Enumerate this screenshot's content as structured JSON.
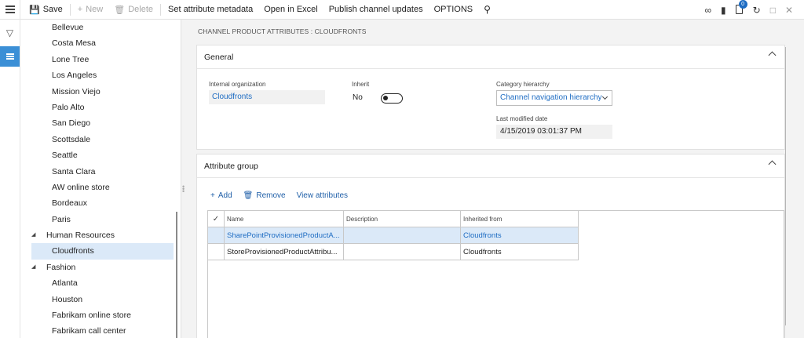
{
  "toolbar": {
    "save": "Save",
    "new": "New",
    "delete": "Delete",
    "set_attribute_metadata": "Set attribute metadata",
    "open_in_excel": "Open in Excel",
    "publish_channel_updates": "Publish channel updates",
    "options": "OPTIONS",
    "notification_count": "0"
  },
  "tree": {
    "items": [
      {
        "label": "Bellevue",
        "type": "leaf"
      },
      {
        "label": "Costa Mesa",
        "type": "leaf"
      },
      {
        "label": "Lone Tree",
        "type": "leaf"
      },
      {
        "label": "Los Angeles",
        "type": "leaf"
      },
      {
        "label": "Mission Viejo",
        "type": "leaf"
      },
      {
        "label": "Palo Alto",
        "type": "leaf"
      },
      {
        "label": "San Diego",
        "type": "leaf"
      },
      {
        "label": "Scottsdale",
        "type": "leaf"
      },
      {
        "label": "Seattle",
        "type": "leaf"
      },
      {
        "label": "Santa Clara",
        "type": "leaf"
      },
      {
        "label": "AW online store",
        "type": "leaf"
      },
      {
        "label": "Bordeaux",
        "type": "leaf"
      },
      {
        "label": "Paris",
        "type": "leaf"
      },
      {
        "label": "Human Resources",
        "type": "group"
      },
      {
        "label": "Cloudfronts",
        "type": "leaf",
        "selected": true
      },
      {
        "label": "Fashion",
        "type": "group"
      },
      {
        "label": "Atlanta",
        "type": "leaf"
      },
      {
        "label": "Houston",
        "type": "leaf"
      },
      {
        "label": "Fabrikam online store",
        "type": "leaf"
      },
      {
        "label": "Fabrikam call center",
        "type": "leaf"
      }
    ]
  },
  "breadcrumb": "CHANNEL PRODUCT ATTRIBUTES : CLOUDFRONTS",
  "general": {
    "title": "General",
    "internal_org_label": "Internal organization",
    "internal_org_value": "Cloudfronts",
    "inherit_label": "Inherit",
    "inherit_value": "No",
    "category_label": "Category hierarchy",
    "category_value": "Channel navigation hierarchy",
    "modified_label": "Last modified date",
    "modified_value": "4/15/2019 03:01:37 PM"
  },
  "attribute_group": {
    "title": "Attribute group",
    "add": "Add",
    "remove": "Remove",
    "view": "View attributes",
    "columns": [
      "Name",
      "Description",
      "Inherited from"
    ],
    "rows": [
      {
        "name": "SharePointProvisionedProductA...",
        "description": "",
        "inherited": "Cloudfronts"
      },
      {
        "name": "StoreProvisionedProductAttribu...",
        "description": "",
        "inherited": "Cloudfronts"
      }
    ]
  },
  "colors": {
    "accent": "#3b8fd6",
    "link": "#1f6dc3",
    "selection": "#dbe9f8"
  }
}
